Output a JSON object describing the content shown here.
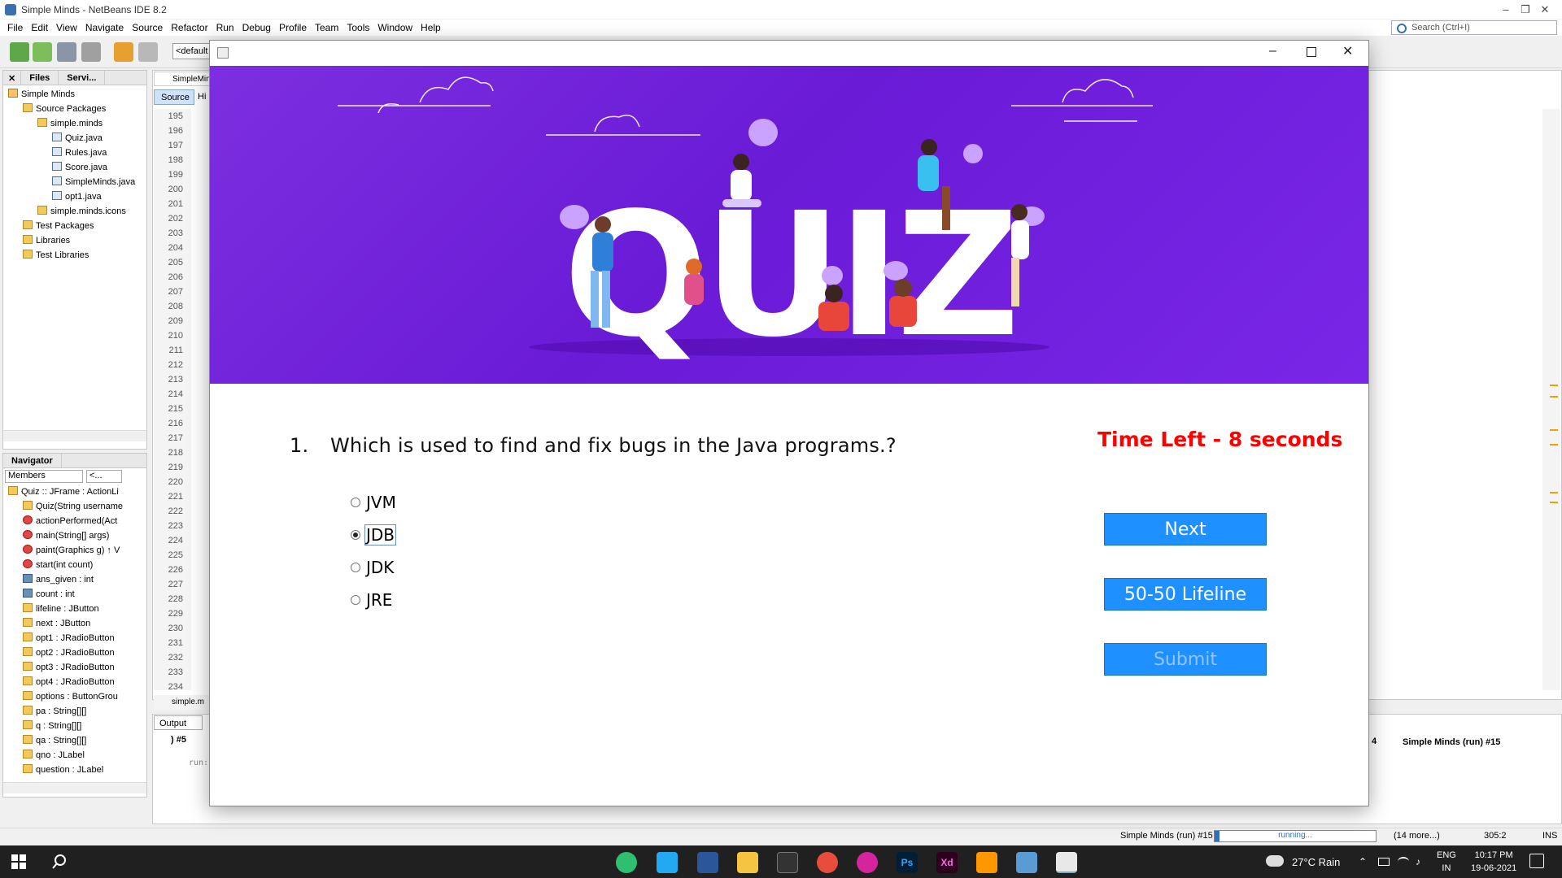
{
  "ide": {
    "title": "Simple Minds - NetBeans IDE 8.2",
    "menu": [
      "File",
      "Edit",
      "View",
      "Navigate",
      "Source",
      "Refactor",
      "Run",
      "Debug",
      "Profile",
      "Team",
      "Tools",
      "Window",
      "Help"
    ],
    "search_placeholder": "Search (Ctrl+I)",
    "config_combo": "<default",
    "projects_tabs": [
      "Files",
      "Servi..."
    ],
    "project_tree": [
      {
        "label": "Simple Minds",
        "icon": "project-icon",
        "level": 0
      },
      {
        "label": "Source Packages",
        "icon": "folder-icon",
        "level": 1
      },
      {
        "label": "simple.minds",
        "icon": "package-icon",
        "level": 2
      },
      {
        "label": "Quiz.java",
        "icon": "java-file-icon",
        "level": 3
      },
      {
        "label": "Rules.java",
        "icon": "java-file-icon",
        "level": 3
      },
      {
        "label": "Score.java",
        "icon": "java-file-icon",
        "level": 3
      },
      {
        "label": "SimpleMinds.java",
        "icon": "java-file-icon",
        "level": 3
      },
      {
        "label": "opt1.java",
        "icon": "java-file-icon",
        "level": 3
      },
      {
        "label": "simple.minds.icons",
        "icon": "package-icon",
        "level": 2
      },
      {
        "label": "Test Packages",
        "icon": "folder-icon",
        "level": 1
      },
      {
        "label": "Libraries",
        "icon": "folder-icon",
        "level": 1
      },
      {
        "label": "Test Libraries",
        "icon": "folder-icon",
        "level": 1
      }
    ],
    "navigator_title": "Navigator",
    "navigator_filter": "Members",
    "navigator_filter2": "<...",
    "navigator_items": [
      "Quiz :: JFrame : ActionLi",
      "Quiz(String username",
      "actionPerformed(Act",
      "main(String[] args)",
      "paint(Graphics g) ↑ V",
      "start(int count)",
      "ans_given : int",
      "count : int",
      "lifeline : JButton",
      "next : JButton",
      "opt1 : JRadioButton",
      "opt2 : JRadioButton",
      "opt3 : JRadioButton",
      "opt4 : JRadioButton",
      "options : ButtonGrou",
      "pa : String[][]",
      "q : String[][]",
      "qa : String[][]",
      "qno : JLabel",
      "question : JLabel"
    ],
    "editor_tab": "SimpleMin",
    "source_button": "Source",
    "history_button": "Hi",
    "line_numbers": [
      "195",
      "196",
      "197",
      "198",
      "199",
      "200",
      "201",
      "202",
      "203",
      "204",
      "205",
      "206",
      "207",
      "208",
      "209",
      "210",
      "211",
      "212",
      "213",
      "214",
      "215",
      "216",
      "217",
      "218",
      "219",
      "220",
      "221",
      "222",
      "223",
      "224",
      "225",
      "226",
      "227",
      "228",
      "229",
      "230",
      "231",
      "232",
      "233",
      "234"
    ],
    "breadcrumb": "simple.m",
    "output_tab": "Output",
    "output_subtab": ") #5",
    "output_line": "run:",
    "run_tab_prev": "4",
    "run_tab": "Simple Minds (run) #15",
    "status": {
      "task": "Simple Minds (run) #15",
      "progress": "running...",
      "more": "(14 more...)",
      "pos": "305:2",
      "mode": "INS"
    }
  },
  "quiz": {
    "question_number": "1.",
    "question": "Which is used to find and fix bugs in the Java programs.?",
    "timer": "Time Left - 8 seconds",
    "options": [
      {
        "label": "JVM",
        "selected": false
      },
      {
        "label": "JDB",
        "selected": true
      },
      {
        "label": "JDK",
        "selected": false
      },
      {
        "label": "JRE",
        "selected": false
      }
    ],
    "buttons": {
      "next": "Next",
      "lifeline": "50-50 Lifeline",
      "submit": "Submit"
    },
    "banner_word": "QUIZ",
    "colors": {
      "banner": "#6a1bd6",
      "timer": "#ff0000",
      "button": "#1e90ff"
    }
  },
  "taskbar": {
    "weather": "27°C  Rain",
    "lang": "ENG",
    "region": "IN",
    "time": "10:17 PM",
    "date": "19-06-2021"
  }
}
